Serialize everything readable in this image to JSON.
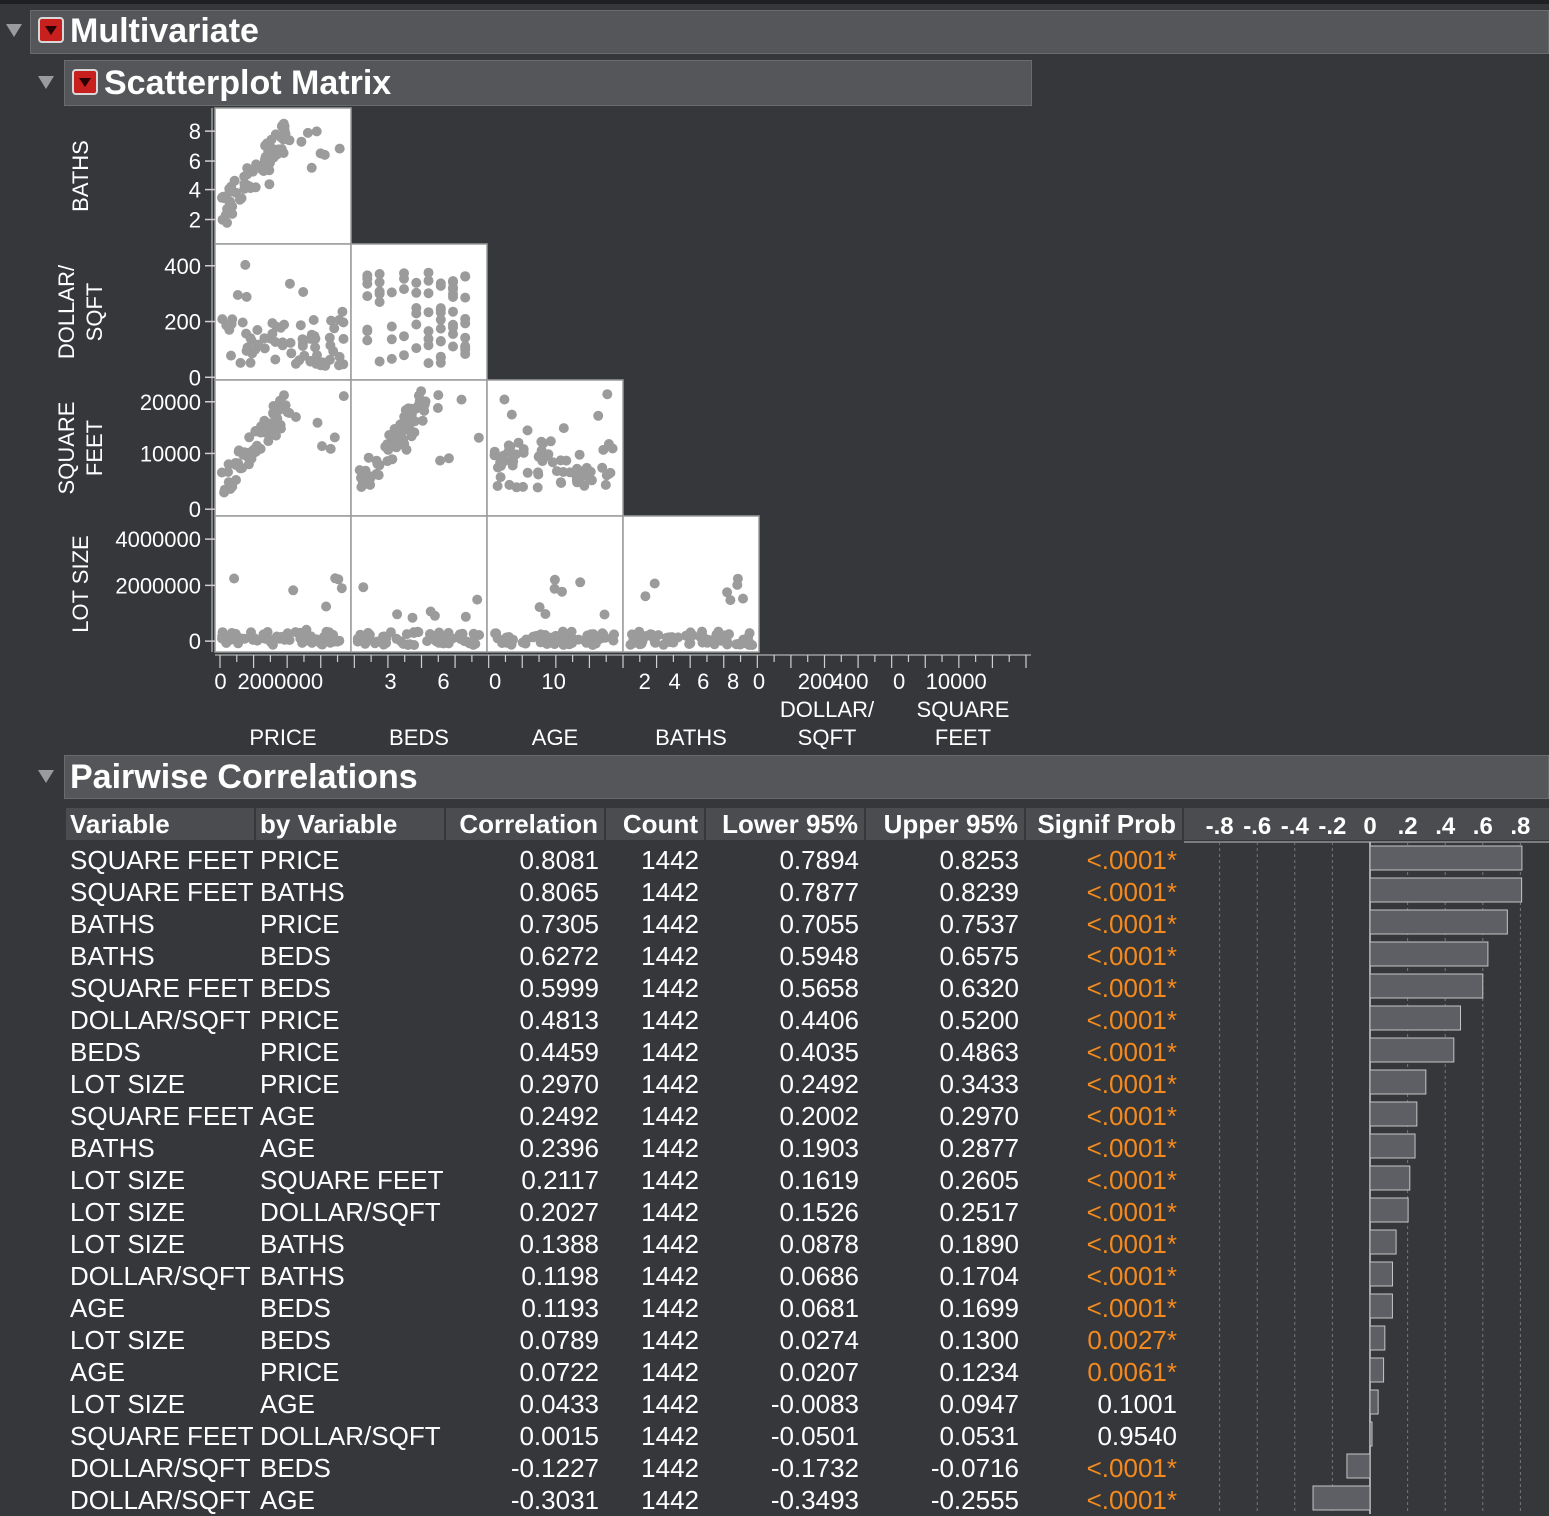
{
  "multivariate": {
    "title": "Multivariate"
  },
  "scatterplot_matrix": {
    "title": "Scatterplot Matrix",
    "row_labels": [
      [
        "BATHS"
      ],
      [
        "DOLLAR/",
        "SQFT"
      ],
      [
        "SQUARE",
        "FEET"
      ],
      [
        "LOT SIZE"
      ]
    ],
    "col_labels": [
      [
        "PRICE"
      ],
      [
        "BEDS"
      ],
      [
        "AGE"
      ],
      [
        "BATHS"
      ],
      [
        "DOLLAR/",
        "SQFT"
      ],
      [
        "SQUARE",
        "FEET"
      ]
    ],
    "row_ticks": [
      [
        "8",
        "6",
        "4",
        "2"
      ],
      [
        "400",
        "200",
        "0"
      ],
      [
        "20000",
        "10000",
        "0"
      ],
      [
        "4000000",
        "2000000",
        "0"
      ]
    ],
    "col_ticks": [
      [
        "0",
        "2000000"
      ],
      [
        "3",
        "6"
      ],
      [
        "0",
        "10"
      ],
      [
        "2",
        "4",
        "6",
        "8"
      ],
      [
        "0",
        "200",
        "400"
      ],
      [
        "0",
        "10000"
      ]
    ]
  },
  "pairwise": {
    "title": "Pairwise Correlations",
    "columns": [
      "Variable",
      "by Variable",
      "Correlation",
      "Count",
      "Lower 95%",
      "Upper 95%",
      "Signif Prob"
    ],
    "bar_axis_ticks": [
      "-.8",
      "-.6",
      "-.4",
      "-.2",
      "0",
      ".2",
      ".4",
      ".6",
      ".8"
    ],
    "rows": [
      {
        "var": "SQUARE FEET",
        "by": "PRICE",
        "corr": "0.8081",
        "count": "1442",
        "lower": "0.7894",
        "upper": "0.8253",
        "prob": "<.0001*",
        "sig": true
      },
      {
        "var": "SQUARE FEET",
        "by": "BATHS",
        "corr": "0.8065",
        "count": "1442",
        "lower": "0.7877",
        "upper": "0.8239",
        "prob": "<.0001*",
        "sig": true
      },
      {
        "var": "BATHS",
        "by": "PRICE",
        "corr": "0.7305",
        "count": "1442",
        "lower": "0.7055",
        "upper": "0.7537",
        "prob": "<.0001*",
        "sig": true
      },
      {
        "var": "BATHS",
        "by": "BEDS",
        "corr": "0.6272",
        "count": "1442",
        "lower": "0.5948",
        "upper": "0.6575",
        "prob": "<.0001*",
        "sig": true
      },
      {
        "var": "SQUARE FEET",
        "by": "BEDS",
        "corr": "0.5999",
        "count": "1442",
        "lower": "0.5658",
        "upper": "0.6320",
        "prob": "<.0001*",
        "sig": true
      },
      {
        "var": "DOLLAR/SQFT",
        "by": "PRICE",
        "corr": "0.4813",
        "count": "1442",
        "lower": "0.4406",
        "upper": "0.5200",
        "prob": "<.0001*",
        "sig": true
      },
      {
        "var": "BEDS",
        "by": "PRICE",
        "corr": "0.4459",
        "count": "1442",
        "lower": "0.4035",
        "upper": "0.4863",
        "prob": "<.0001*",
        "sig": true
      },
      {
        "var": "LOT SIZE",
        "by": "PRICE",
        "corr": "0.2970",
        "count": "1442",
        "lower": "0.2492",
        "upper": "0.3433",
        "prob": "<.0001*",
        "sig": true
      },
      {
        "var": "SQUARE FEET",
        "by": "AGE",
        "corr": "0.2492",
        "count": "1442",
        "lower": "0.2002",
        "upper": "0.2970",
        "prob": "<.0001*",
        "sig": true
      },
      {
        "var": "BATHS",
        "by": "AGE",
        "corr": "0.2396",
        "count": "1442",
        "lower": "0.1903",
        "upper": "0.2877",
        "prob": "<.0001*",
        "sig": true
      },
      {
        "var": "LOT SIZE",
        "by": "SQUARE FEET",
        "corr": "0.2117",
        "count": "1442",
        "lower": "0.1619",
        "upper": "0.2605",
        "prob": "<.0001*",
        "sig": true
      },
      {
        "var": "LOT SIZE",
        "by": "DOLLAR/SQFT",
        "corr": "0.2027",
        "count": "1442",
        "lower": "0.1526",
        "upper": "0.2517",
        "prob": "<.0001*",
        "sig": true
      },
      {
        "var": "LOT SIZE",
        "by": "BATHS",
        "corr": "0.1388",
        "count": "1442",
        "lower": "0.0878",
        "upper": "0.1890",
        "prob": "<.0001*",
        "sig": true
      },
      {
        "var": "DOLLAR/SQFT",
        "by": "BATHS",
        "corr": "0.1198",
        "count": "1442",
        "lower": "0.0686",
        "upper": "0.1704",
        "prob": "<.0001*",
        "sig": true
      },
      {
        "var": "AGE",
        "by": "BEDS",
        "corr": "0.1193",
        "count": "1442",
        "lower": "0.0681",
        "upper": "0.1699",
        "prob": "<.0001*",
        "sig": true
      },
      {
        "var": "LOT SIZE",
        "by": "BEDS",
        "corr": "0.0789",
        "count": "1442",
        "lower": "0.0274",
        "upper": "0.1300",
        "prob": "0.0027*",
        "sig": true
      },
      {
        "var": "AGE",
        "by": "PRICE",
        "corr": "0.0722",
        "count": "1442",
        "lower": "0.0207",
        "upper": "0.1234",
        "prob": "0.0061*",
        "sig": true
      },
      {
        "var": "LOT SIZE",
        "by": "AGE",
        "corr": "0.0433",
        "count": "1442",
        "lower": "-0.0083",
        "upper": "0.0947",
        "prob": "0.1001",
        "sig": false
      },
      {
        "var": "SQUARE FEET",
        "by": "DOLLAR/SQFT",
        "corr": "0.0015",
        "count": "1442",
        "lower": "-0.0501",
        "upper": "0.0531",
        "prob": "0.9540",
        "sig": false
      },
      {
        "var": "DOLLAR/SQFT",
        "by": "BEDS",
        "corr": "-0.1227",
        "count": "1442",
        "lower": "-0.1732",
        "upper": "-0.0716",
        "prob": "<.0001*",
        "sig": true
      },
      {
        "var": "DOLLAR/SQFT",
        "by": "AGE",
        "corr": "-0.3031",
        "count": "1442",
        "lower": "-0.3493",
        "upper": "-0.2555",
        "prob": "<.0001*",
        "sig": true
      }
    ]
  },
  "colors": {
    "panel_bg": "#35373b",
    "header_bg": "#555659",
    "signif": "#f28a1e",
    "point": "#9b9b9b",
    "bar": "#5d5f64"
  }
}
